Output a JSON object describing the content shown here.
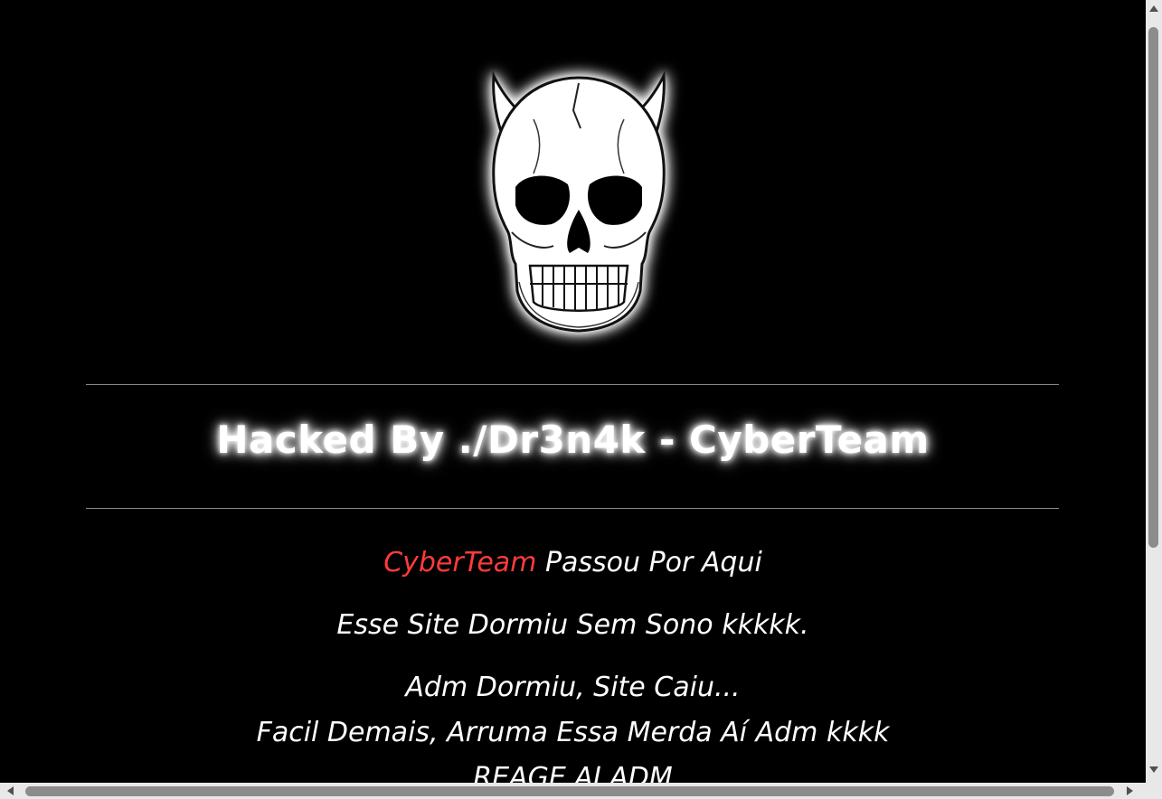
{
  "page": {
    "title": "Hacked By ./Dr3n4k - CyberTeam",
    "line1_accent": "CyberTeam",
    "line1_rest": " Passou Por Aqui",
    "line2": "Esse Site Dormiu Sem Sono kkkkk.",
    "line3": "Adm Dormiu, Site Caiu...",
    "line4": "Facil Demais, Arruma Essa Merda Aí Adm kkkk",
    "line5": "REAGE AI ADM"
  },
  "image": {
    "icon": "horned-skull-icon"
  },
  "colors": {
    "background": "#000000",
    "text": "#ffffff",
    "accent": "#ff3b3b",
    "divider": "#8a8a8a"
  }
}
